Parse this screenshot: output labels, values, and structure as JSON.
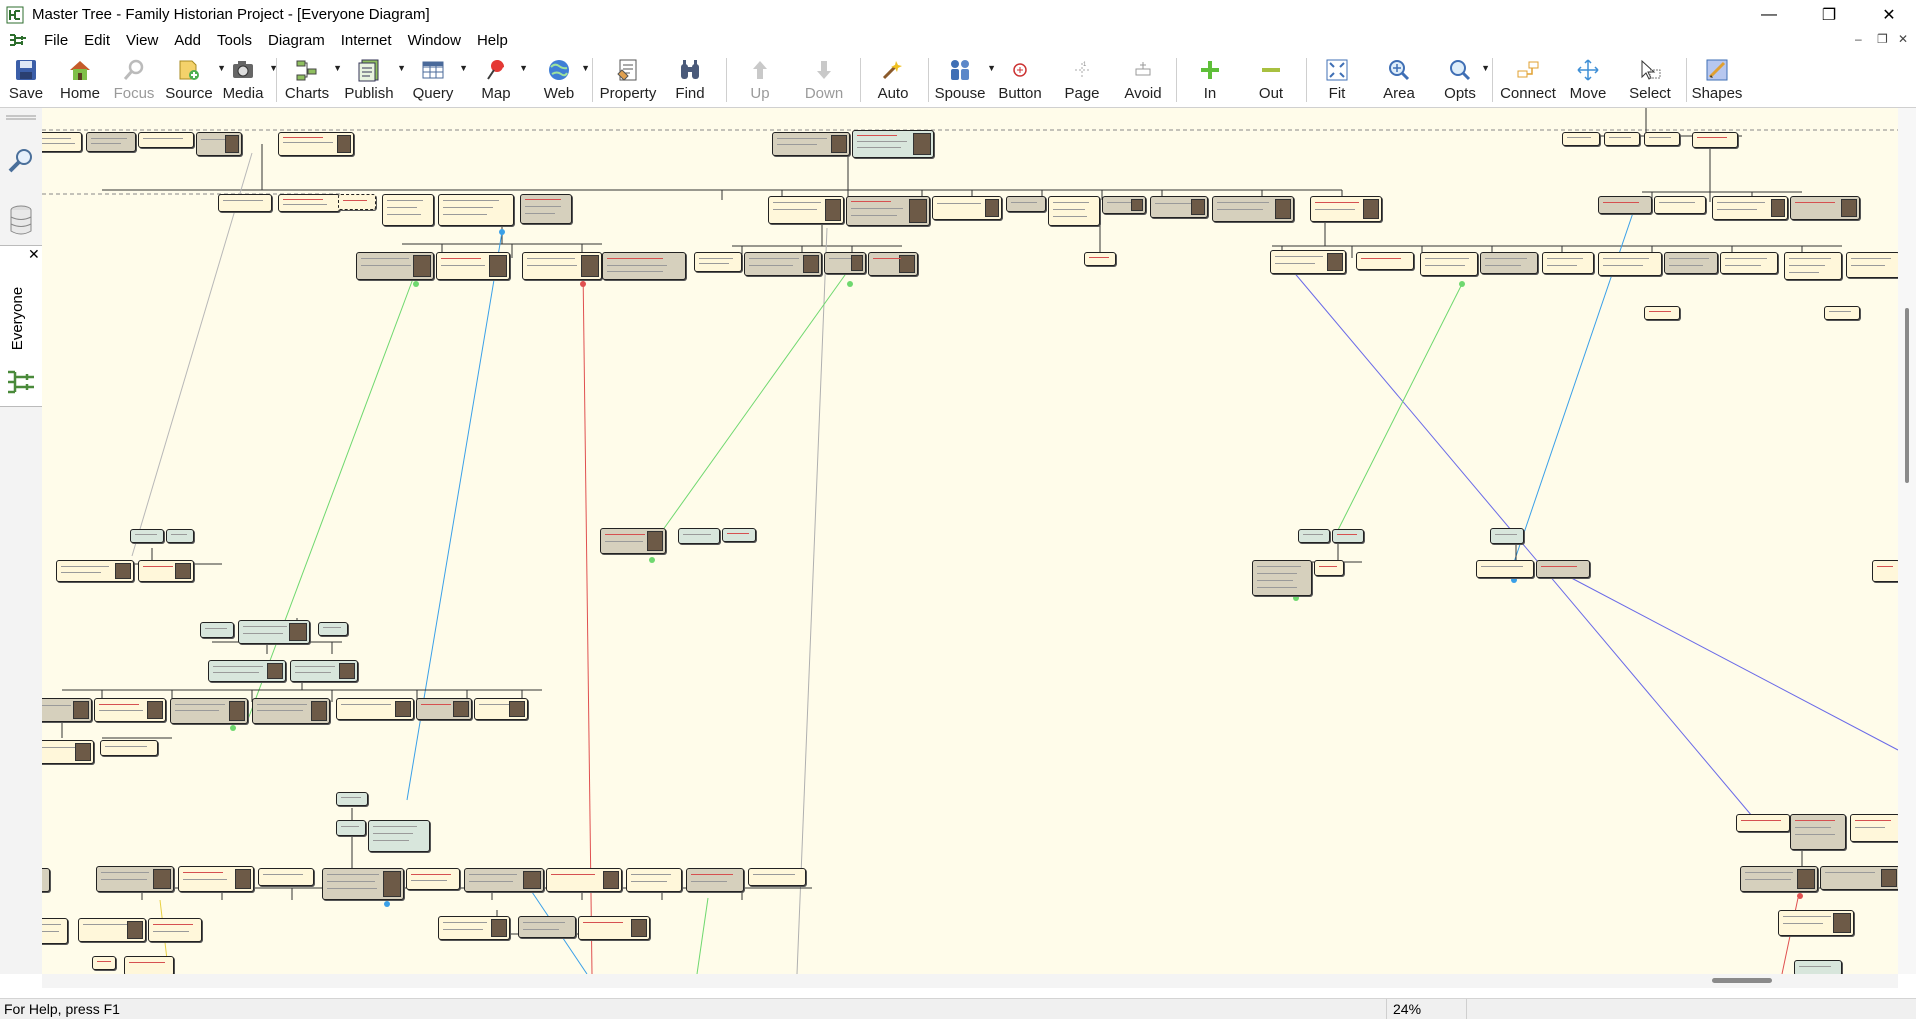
{
  "window": {
    "title": "Master Tree - Family Historian Project - [Everyone Diagram]",
    "minimize_glyph": "—",
    "restore_glyph": "❐",
    "close_glyph": "✕"
  },
  "menu": {
    "items": [
      "File",
      "Edit",
      "View",
      "Add",
      "Tools",
      "Diagram",
      "Internet",
      "Window",
      "Help"
    ],
    "mdi_minimize": "–",
    "mdi_restore": "❐",
    "mdi_close": "✕"
  },
  "toolbar": {
    "buttons": [
      {
        "label": "Save",
        "icon": "save-icon"
      },
      {
        "label": "Home",
        "icon": "home-icon"
      },
      {
        "label": "Focus",
        "icon": "focus-icon",
        "disabled": true
      },
      {
        "label": "Source",
        "icon": "source-icon"
      },
      {
        "label": "Media",
        "icon": "media-icon"
      },
      {
        "label": "Charts",
        "icon": "charts-icon"
      },
      {
        "label": "Publish",
        "icon": "publish-icon"
      },
      {
        "label": "Query",
        "icon": "query-icon"
      },
      {
        "label": "Map",
        "icon": "map-icon"
      },
      {
        "label": "Web",
        "icon": "web-icon"
      },
      {
        "label": "Property",
        "icon": "property-icon"
      },
      {
        "label": "Find",
        "icon": "find-icon"
      },
      {
        "label": "Up",
        "icon": "up-arrow-icon",
        "disabled": true
      },
      {
        "label": "Down",
        "icon": "down-arrow-icon",
        "disabled": true
      },
      {
        "label": "Auto",
        "icon": "auto-icon"
      },
      {
        "label": "Spouse",
        "icon": "spouse-icon"
      },
      {
        "label": "Button",
        "icon": "button-icon"
      },
      {
        "label": "Page",
        "icon": "page-icon"
      },
      {
        "label": "Avoid",
        "icon": "avoid-icon"
      },
      {
        "label": "In",
        "icon": "zoom-in-icon"
      },
      {
        "label": "Out",
        "icon": "zoom-out-icon"
      },
      {
        "label": "Fit",
        "icon": "fit-icon"
      },
      {
        "label": "Area",
        "icon": "area-icon"
      },
      {
        "label": "Opts",
        "icon": "opts-icon"
      },
      {
        "label": "Connect",
        "icon": "connect-icon"
      },
      {
        "label": "Move",
        "icon": "move-icon"
      },
      {
        "label": "Select",
        "icon": "select-icon"
      },
      {
        "label": "Shapes",
        "icon": "shapes-icon"
      }
    ]
  },
  "side_panel": {
    "tab_label": "Everyone",
    "close_glyph": "✕"
  },
  "status": {
    "help_text": "For Help, press F1",
    "zoom": "24%"
  },
  "colors": {
    "canvas": "#fffcea",
    "male_box": "#d8e6dc",
    "female_box": "#fff7da",
    "link_blue": "#3aa0e8",
    "link_green": "#6fd86f",
    "link_red": "#e05050",
    "link_purple": "#6a6ae8"
  }
}
